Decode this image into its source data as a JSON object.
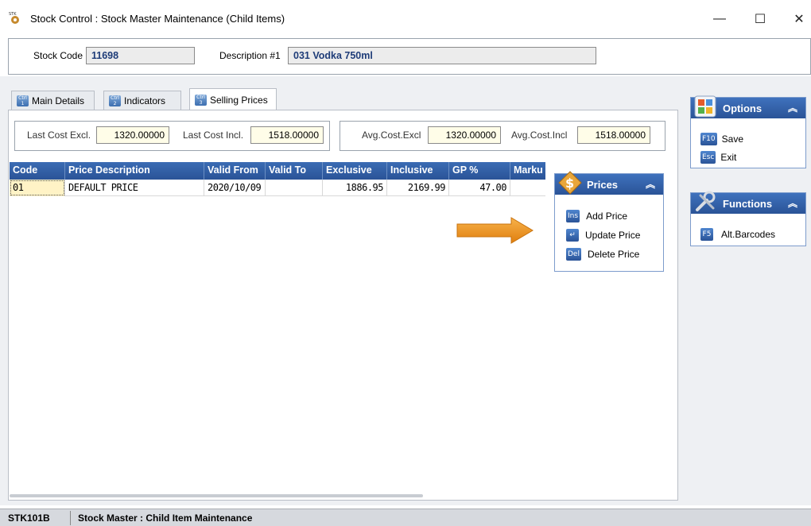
{
  "window": {
    "title": "Stock Control : Stock Master Maintenance (Child Items)",
    "app_icon": "stk-app-icon",
    "minimize": "—",
    "maximize": "☐",
    "close": "✕"
  },
  "header": {
    "stock_code_label": "Stock Code",
    "stock_code_value": "11698",
    "description_label": "Description #1",
    "description_value": "031 Vodka 750ml"
  },
  "tabs": [
    {
      "label": "Main Details",
      "key": "Ctrl 1",
      "active": false
    },
    {
      "label": "Indicators",
      "key": "Ctrl 2",
      "active": false
    },
    {
      "label": "Selling Prices",
      "key": "Ctrl 3",
      "active": true
    }
  ],
  "costs": {
    "last_cost_excl_label": "Last Cost Excl.",
    "last_cost_excl_value": "1320.00000",
    "last_cost_incl_label": "Last Cost Incl.",
    "last_cost_incl_value": "1518.00000",
    "avg_cost_excl_label": "Avg.Cost.Excl",
    "avg_cost_excl_value": "1320.00000",
    "avg_cost_incl_label": "Avg.Cost.Incl",
    "avg_cost_incl_value": "1518.00000"
  },
  "grid": {
    "columns": [
      "Code",
      "Price Description",
      "Valid From",
      "Valid To",
      "Exclusive",
      "Inclusive",
      "GP %",
      "Marku"
    ],
    "rows": [
      [
        "01",
        "DEFAULT PRICE",
        "2020/10/09",
        "",
        "1886.95",
        "2169.99",
        "47.00",
        ""
      ]
    ]
  },
  "prices_panel": {
    "title": "Prices",
    "icon": "dollar-icon",
    "collapse_glyph": "≈",
    "items": [
      {
        "key": "Ins",
        "label": "Add Price"
      },
      {
        "key": "↵",
        "label": "Update Price"
      },
      {
        "key": "Del",
        "label": "Delete Price"
      }
    ]
  },
  "options_panel": {
    "title": "Options",
    "icon": "options-icon",
    "collapse_glyph": "≈",
    "items": [
      {
        "key": "F10",
        "label": "Save"
      },
      {
        "key": "Esc",
        "label": "Exit"
      }
    ]
  },
  "functions_panel": {
    "title": "Functions",
    "icon": "tools-icon",
    "collapse_glyph": "≈",
    "items": [
      {
        "key": "F5",
        "label": "Alt.Barcodes"
      }
    ]
  },
  "status": {
    "code": "STK101B",
    "text": "Stock Master : Child Item Maintenance"
  },
  "colors": {
    "header_blue": "#2a5397",
    "arrow_orange": "#f39b1c",
    "input_cream": "#fffde8"
  }
}
